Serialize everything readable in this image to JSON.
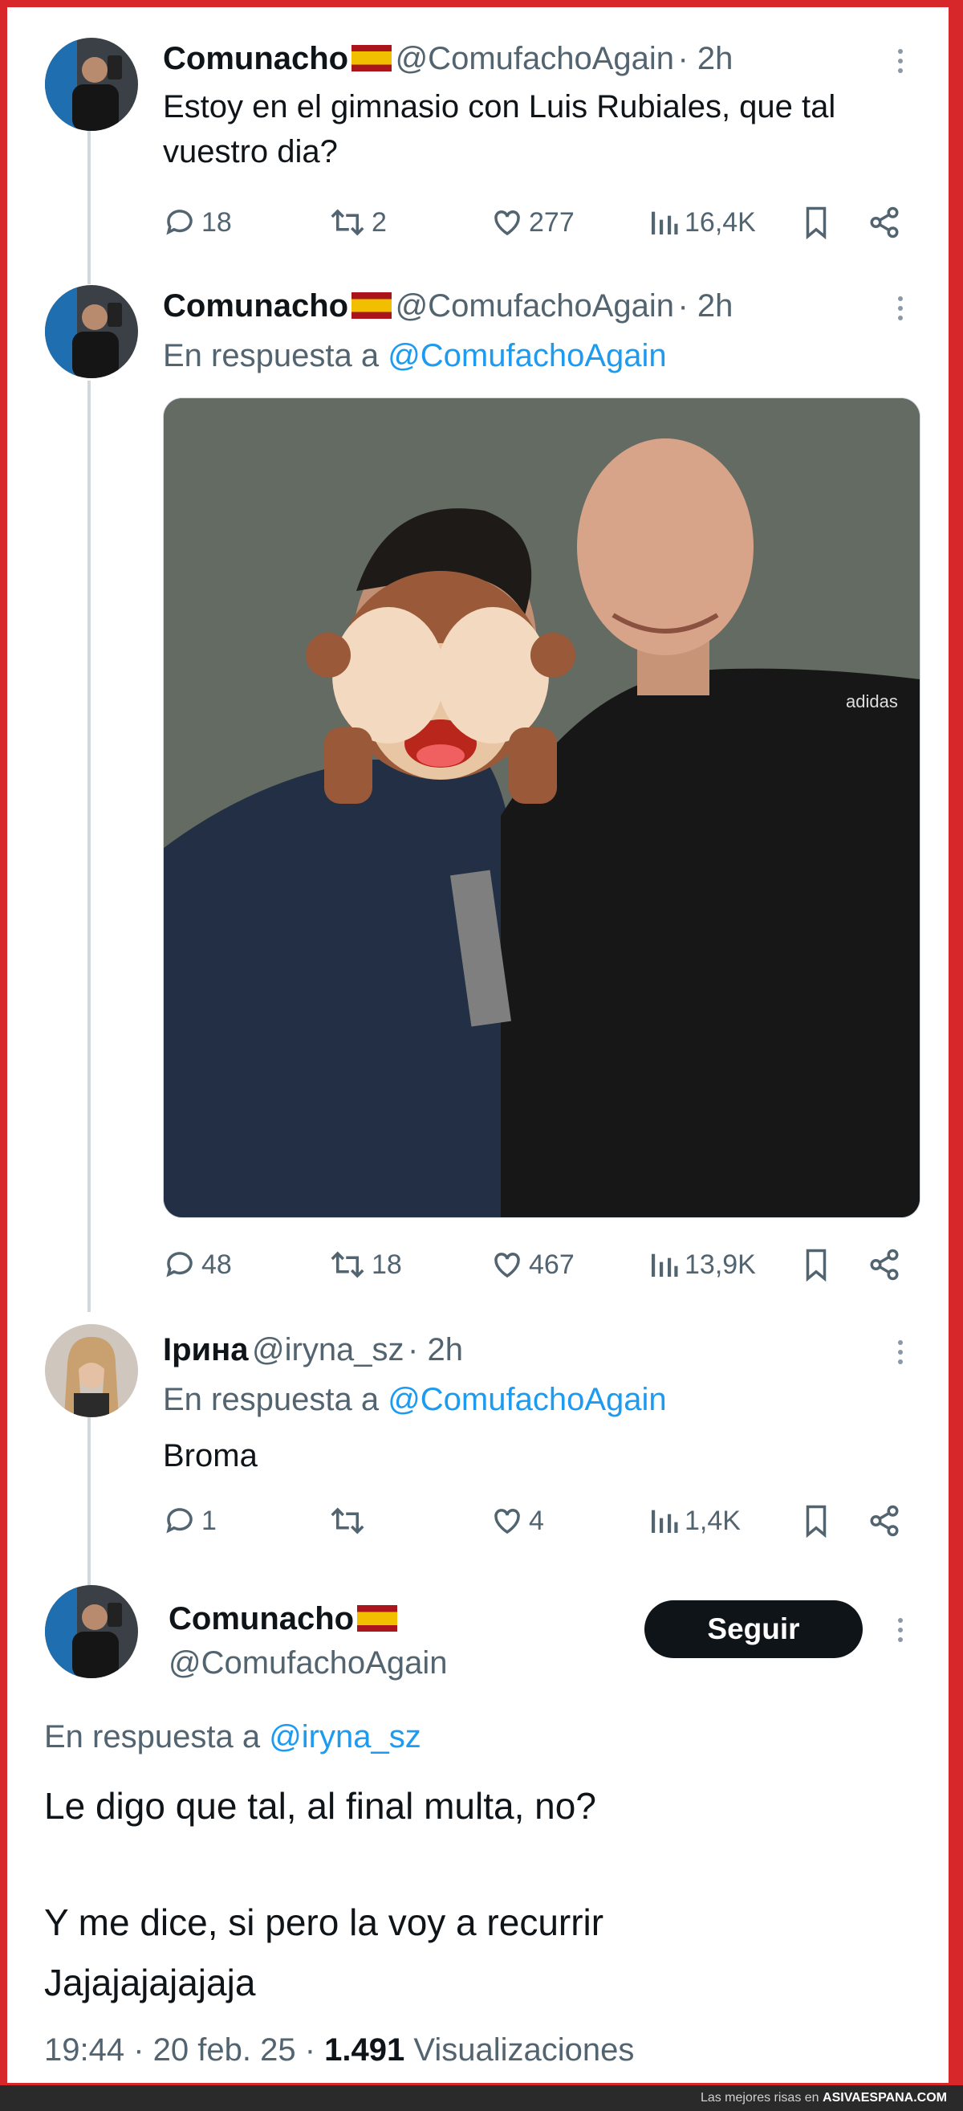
{
  "tweets": [
    {
      "name": "Comunacho",
      "handle": "@ComufachoAgain",
      "time": "· 2h",
      "text": "Estoy en el gimnasio con Luis Rubiales, que tal vuestro dia?",
      "replies": "18",
      "retweets": "2",
      "likes": "277",
      "views": "16,4K"
    },
    {
      "name": "Comunacho",
      "handle": "@ComufachoAgain",
      "time": "· 2h",
      "reply_prefix": "En respuesta a",
      "reply_to": "@ComufachoAgain",
      "replies": "48",
      "retweets": "18",
      "likes": "467",
      "views": "13,9K",
      "media_logo": "adidas"
    },
    {
      "name": "Ірина",
      "handle": "@iryna_sz",
      "time": "· 2h",
      "reply_prefix": "En respuesta a",
      "reply_to": "@ComufachoAgain",
      "text": "Broma",
      "replies": "1",
      "retweets": "",
      "likes": "4",
      "views": "1,4K"
    },
    {
      "name": "Comunacho",
      "handle": "@ComufachoAgain",
      "follow_label": "Seguir",
      "reply_prefix": "En respuesta a",
      "reply_to": "@iryna_sz",
      "text_line1": "Le digo que tal, al final multa, no?",
      "text_line2": "Y me dice, si pero la voy a recurrir",
      "text_line3": "Jajajajajajaja",
      "time_full": "19:44 · 20 feb. 25 ·",
      "views_count": "1.491",
      "views_label": "Visualizaciones"
    }
  ],
  "footer": {
    "prefix": "Las mejores risas en",
    "site": "ASIVAESPANA.COM"
  },
  "colors": {
    "frame": "#d8272a",
    "link": "#1d9bf0",
    "muted": "#536471"
  },
  "icons": [
    "reply-icon",
    "retweet-icon",
    "like-icon",
    "views-icon",
    "bookmark-icon",
    "share-icon",
    "more-icon",
    "spain-flag-icon"
  ]
}
